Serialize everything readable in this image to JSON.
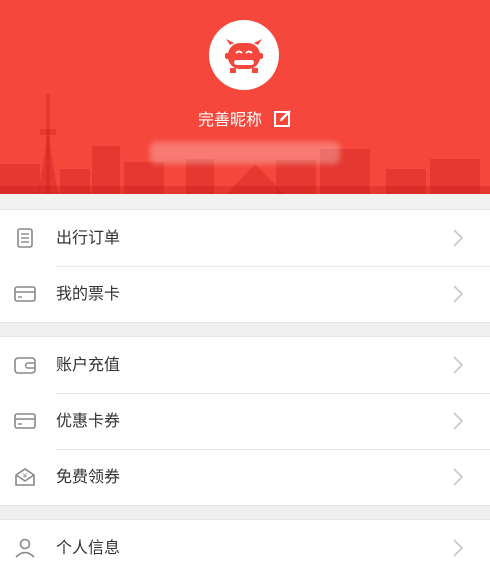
{
  "profile": {
    "nickname": "完善昵称",
    "avatar_icon": "car-face-icon",
    "edit_icon": "edit-icon"
  },
  "menu": {
    "group1": [
      {
        "label": "出行订单",
        "icon": "order-list-icon"
      },
      {
        "label": "我的票卡",
        "icon": "ticket-card-icon"
      }
    ],
    "group2": [
      {
        "label": "账户充值",
        "icon": "wallet-icon"
      },
      {
        "label": "优惠卡券",
        "icon": "coupon-card-icon"
      },
      {
        "label": "免费领券",
        "icon": "gift-envelope-icon"
      }
    ],
    "group3": [
      {
        "label": "个人信息",
        "icon": "user-icon"
      }
    ]
  },
  "colors": {
    "brand_red": "#f5473c",
    "text": "#333333",
    "icon_gray": "#888888",
    "chevron_gray": "#c7c7c7"
  }
}
